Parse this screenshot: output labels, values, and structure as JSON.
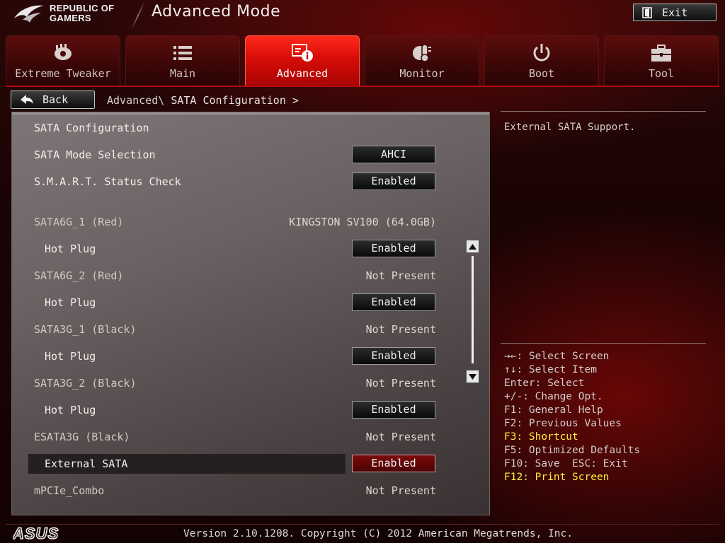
{
  "header": {
    "brand_line1": "REPUBLIC OF",
    "brand_line2": "GAMERS",
    "mode_title": "Advanced Mode",
    "exit_label": "Exit"
  },
  "tabs": [
    {
      "label": "Extreme Tweaker",
      "icon": "tweaker-icon",
      "active": false
    },
    {
      "label": "Main",
      "icon": "list-icon",
      "active": false
    },
    {
      "label": "Advanced",
      "icon": "advanced-info-icon",
      "active": true
    },
    {
      "label": "Monitor",
      "icon": "thermometer-icon",
      "active": false
    },
    {
      "label": "Boot",
      "icon": "power-icon",
      "active": false
    },
    {
      "label": "Tool",
      "icon": "toolbox-icon",
      "active": false
    }
  ],
  "nav": {
    "back_label": "Back",
    "breadcrumb_parent": "Advanced\\ ",
    "breadcrumb_current": "SATA Configuration >"
  },
  "settings": {
    "rows": [
      {
        "label": "SATA Configuration",
        "indent": 0,
        "type": "heading"
      },
      {
        "label": "SATA Mode Selection",
        "indent": 0,
        "type": "option",
        "value": "AHCI"
      },
      {
        "label": "S.M.A.R.T. Status Check",
        "indent": 0,
        "type": "option",
        "value": "Enabled"
      },
      {
        "label": "SATA6G_1 (Red)",
        "indent": 0,
        "type": "info",
        "value": "KINGSTON SV100 (64.0GB)"
      },
      {
        "label": "Hot Plug",
        "indent": 1,
        "type": "option",
        "value": "Enabled"
      },
      {
        "label": "SATA6G_2 (Red)",
        "indent": 0,
        "type": "info",
        "value": "Not Present"
      },
      {
        "label": "Hot Plug",
        "indent": 1,
        "type": "option",
        "value": "Enabled"
      },
      {
        "label": "SATA3G_1 (Black)",
        "indent": 0,
        "type": "info",
        "value": "Not Present"
      },
      {
        "label": "Hot Plug",
        "indent": 1,
        "type": "option",
        "value": "Enabled"
      },
      {
        "label": "SATA3G_2 (Black)",
        "indent": 0,
        "type": "info",
        "value": "Not Present"
      },
      {
        "label": "Hot Plug",
        "indent": 1,
        "type": "option",
        "value": "Enabled"
      },
      {
        "label": "ESATA3G (Black)",
        "indent": 0,
        "type": "info",
        "value": "Not Present"
      },
      {
        "label": "External SATA",
        "indent": 1,
        "type": "option",
        "value": "Enabled",
        "selected": true
      },
      {
        "label": "mPCIe_Combo",
        "indent": 0,
        "type": "info",
        "value": "Not Present"
      }
    ]
  },
  "help": {
    "description": "External SATA Support."
  },
  "key_legend": [
    {
      "text": "→←: Select Screen",
      "highlight": false
    },
    {
      "text": "↑↓: Select Item",
      "highlight": false
    },
    {
      "text": "Enter: Select",
      "highlight": false
    },
    {
      "text": "+/-: Change Opt.",
      "highlight": false
    },
    {
      "text": "F1: General Help",
      "highlight": false
    },
    {
      "text": "F2: Previous Values",
      "highlight": false
    },
    {
      "text": "F3: Shortcut",
      "highlight": true
    },
    {
      "text": "F5: Optimized Defaults",
      "highlight": false
    },
    {
      "text": "F10: Save  ESC: Exit",
      "highlight": false
    },
    {
      "text": "F12: Print Screen",
      "highlight": true
    }
  ],
  "footer": {
    "brand": "ASUS",
    "version": "Version 2.10.1208. Copyright (C) 2012 American Megatrends, Inc."
  },
  "colors": {
    "accent_red": "#d60c08",
    "highlight_yellow": "#ffef3a",
    "selected_value_bg": "#7a0a0a"
  }
}
